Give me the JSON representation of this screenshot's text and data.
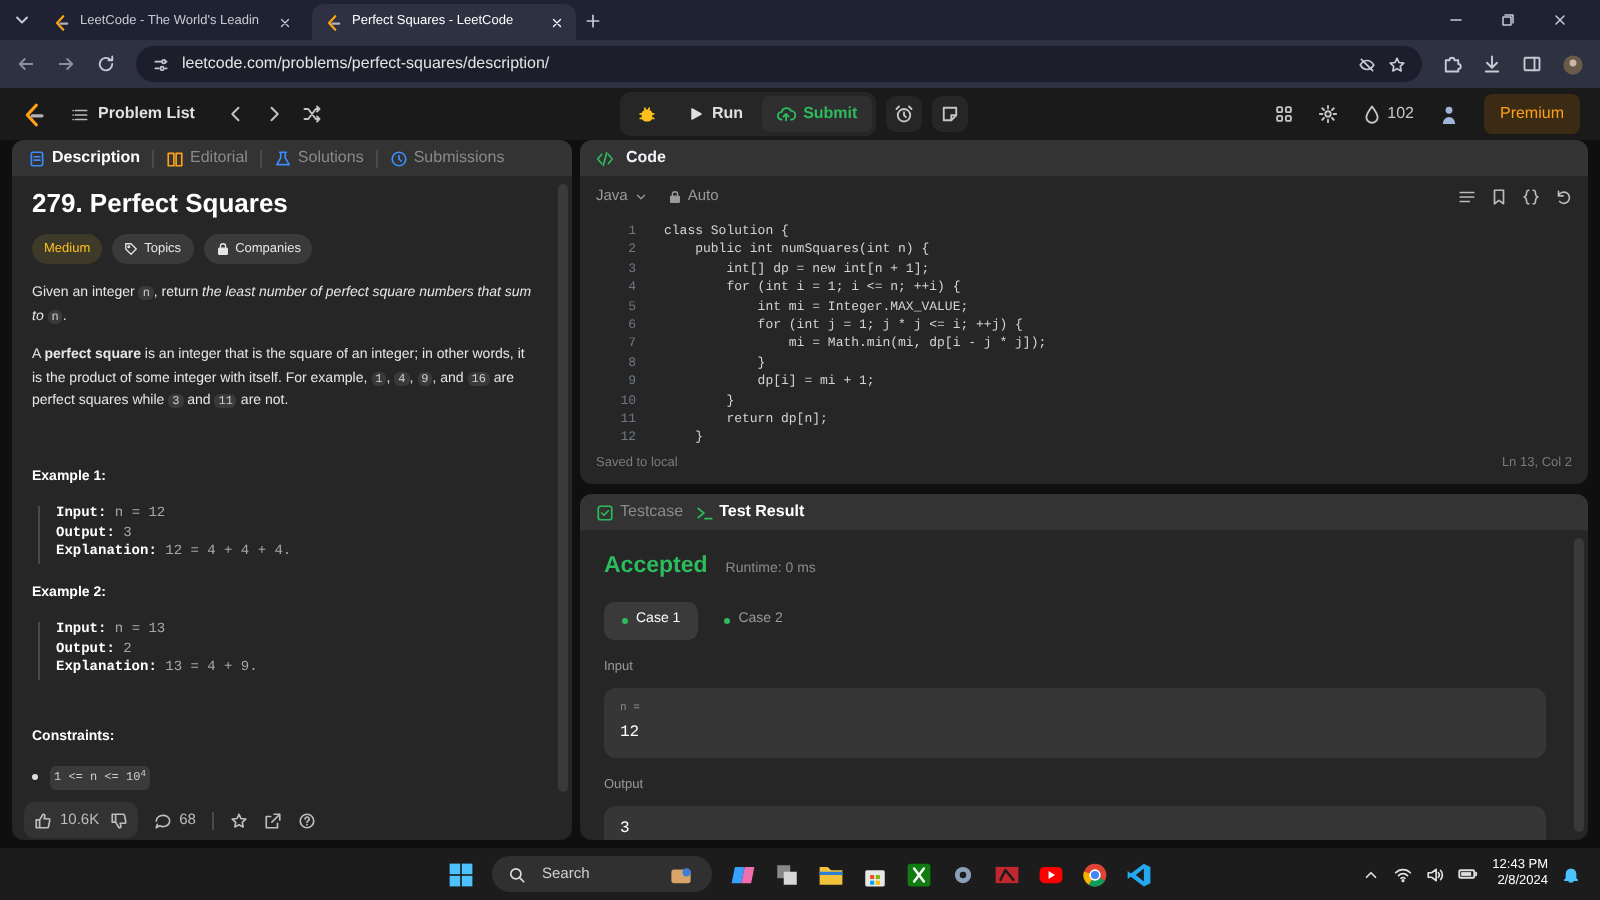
{
  "browser": {
    "tabs": [
      {
        "title": "LeetCode - The World's Leadin",
        "selected": false
      },
      {
        "title": "Perfect Squares - LeetCode",
        "selected": true
      }
    ],
    "url": "leetcode.com/problems/perfect-squares/description/"
  },
  "nav": {
    "problem_list": "Problem List",
    "run": "Run",
    "submit": "Submit",
    "streak": "102",
    "premium": "Premium"
  },
  "description_panel": {
    "tabs": [
      {
        "label": "Description",
        "selected": true
      },
      {
        "label": "Editorial",
        "selected": false
      },
      {
        "label": "Solutions",
        "selected": false
      },
      {
        "label": "Submissions",
        "selected": false
      }
    ],
    "title": "279. Perfect Squares",
    "difficulty": "Medium",
    "tags": [
      "Topics",
      "Companies"
    ],
    "paragraphs": [
      [
        {
          "kind": "text",
          "text": "Given an integer "
        },
        {
          "kind": "code",
          "text": "n"
        },
        {
          "kind": "text",
          "text": ", return *the least number of perfect square numbers that sum to* "
        },
        {
          "kind": "code",
          "text": "n"
        },
        {
          "kind": "text",
          "text": "."
        }
      ],
      [
        {
          "kind": "text",
          "text": "A **perfect square** is an integer that is the square of an integer; in other words, it is the product of some integer with itself. For example, "
        },
        {
          "kind": "code",
          "text": "1"
        },
        {
          "kind": "text",
          "text": ", "
        },
        {
          "kind": "code",
          "text": "4"
        },
        {
          "kind": "text",
          "text": ", "
        },
        {
          "kind": "code",
          "text": "9"
        },
        {
          "kind": "text",
          "text": ", and "
        },
        {
          "kind": "code",
          "text": "16"
        },
        {
          "kind": "text",
          "text": " are perfect squares while "
        },
        {
          "kind": "code",
          "text": "3"
        },
        {
          "kind": "text",
          "text": " and "
        },
        {
          "kind": "code",
          "text": "11"
        },
        {
          "kind": "text",
          "text": " are not."
        }
      ]
    ],
    "examples": [
      {
        "heading": "Example 1:",
        "lines": [
          {
            "label": "Input:",
            "value": "n = 12"
          },
          {
            "label": "Output:",
            "value": "3"
          },
          {
            "label": "Explanation:",
            "value": "12 = 4 + 4 + 4."
          }
        ]
      },
      {
        "heading": "Example 2:",
        "lines": [
          {
            "label": "Input:",
            "value": "n = 13"
          },
          {
            "label": "Output:",
            "value": "2"
          },
          {
            "label": "Explanation:",
            "value": "13 = 4 + 9."
          }
        ]
      }
    ],
    "constraints": {
      "heading": "Constraints:",
      "items": [
        "1 <= n <= 10$^{4}$"
      ]
    },
    "footer": {
      "likes": "10.6K",
      "comments": "68"
    }
  },
  "code_panel": {
    "title": "Code",
    "language": "Java",
    "mode": "Auto",
    "lines": [
      {
        "number": "1",
        "code": "class Solution {"
      },
      {
        "number": "2",
        "code": "    public int numSquares(int n) {"
      },
      {
        "number": "3",
        "code": "        int[] dp = new int[n + 1];"
      },
      {
        "number": "4",
        "code": "        for (int i = 1; i <= n; ++i) {"
      },
      {
        "number": "5",
        "code": "            int mi = Integer.MAX_VALUE;"
      },
      {
        "number": "6",
        "code": "            for (int j = 1; j * j <= i; ++j) {"
      },
      {
        "number": "7",
        "code": "                mi = Math.min(mi, dp[i - j * j]);"
      },
      {
        "number": "8",
        "code": "            }"
      },
      {
        "number": "9",
        "code": "            dp[i] = mi + 1;"
      },
      {
        "number": "10",
        "code": "        }"
      },
      {
        "number": "11",
        "code": "        return dp[n];"
      },
      {
        "number": "12",
        "code": "    }"
      }
    ],
    "status": "Saved to local",
    "cursor": "Ln 13, Col 2"
  },
  "result_panel": {
    "tabs": [
      {
        "label": "Testcase",
        "selected": false
      },
      {
        "label": "Test Result",
        "selected": true
      }
    ],
    "verdict": "Accepted",
    "runtime": "Runtime: 0 ms",
    "cases": [
      {
        "label": "Case 1",
        "selected": true
      },
      {
        "label": "Case 2",
        "selected": false
      }
    ],
    "input_label": "Input",
    "inputs": [
      {
        "name": "n =",
        "value": "12"
      }
    ],
    "output_label": "Output",
    "output": "3"
  },
  "taskbar": {
    "search_placeholder": "Search",
    "time": "12:43 PM",
    "date": "2/8/2024"
  }
}
